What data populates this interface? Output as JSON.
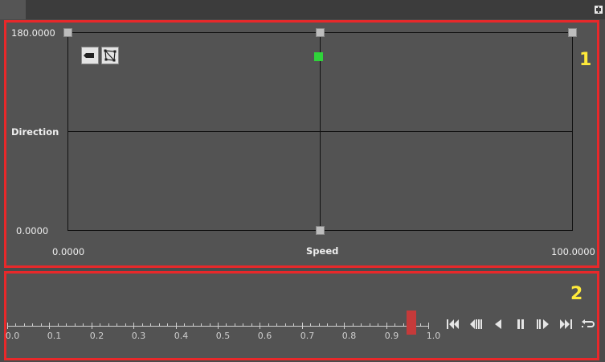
{
  "panel1": {
    "badge": "1",
    "y_axis_max": "180.0000",
    "y_axis_min": "0.0000",
    "y_axis_label": "Direction",
    "x_axis_min": "0.0000",
    "x_axis_max": "100.0000",
    "x_axis_label": "Speed"
  },
  "panel2": {
    "badge": "2",
    "ruler_labels": [
      "0.0",
      "0.1",
      "0.2",
      "0.3",
      "0.4",
      "0.5",
      "0.6",
      "0.7",
      "0.8",
      "0.9",
      "1.0"
    ],
    "playhead_value": 0.96
  },
  "icons": {
    "pin": "pin-icon",
    "tool_label": "label-tool-icon",
    "tool_mesh": "mesh-tool-icon",
    "controls": [
      "skip-to-start-icon",
      "step-back-icon",
      "play-backward-icon",
      "pause-icon",
      "step-forward-icon",
      "skip-to-end-icon",
      "loop-icon"
    ]
  },
  "colors": {
    "highlight_border": "#e8282a",
    "badge": "#ffea3a",
    "sample_point": "#2fd43a",
    "playhead": "#c53a3a"
  }
}
